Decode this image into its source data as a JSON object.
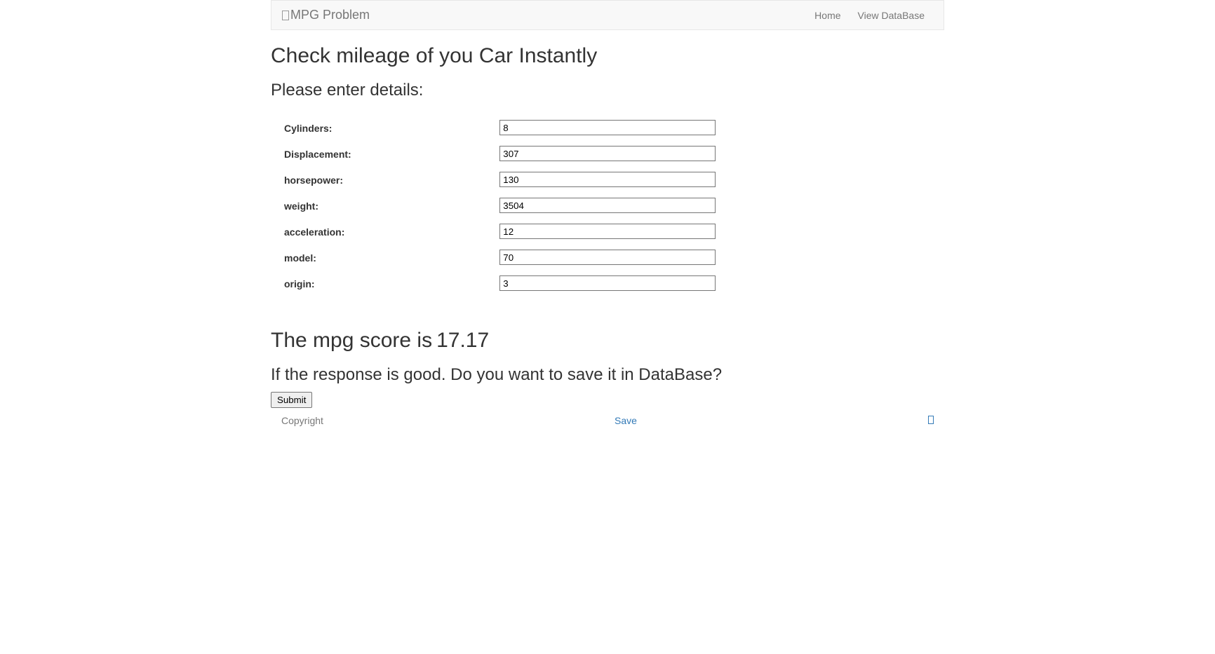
{
  "navbar": {
    "brand": "MPG Problem",
    "links": [
      {
        "label": "Home"
      },
      {
        "label": "View DataBase"
      }
    ]
  },
  "headings": {
    "title": "Check mileage of you Car Instantly",
    "subtitle": "Please enter details:"
  },
  "form": {
    "fields": [
      {
        "label": "Cylinders:",
        "value": "8"
      },
      {
        "label": "Displacement:",
        "value": "307"
      },
      {
        "label": "horsepower:",
        "value": "130"
      },
      {
        "label": "weight:",
        "value": "3504"
      },
      {
        "label": "acceleration:",
        "value": "12"
      },
      {
        "label": "model:",
        "value": "70"
      },
      {
        "label": "origin:",
        "value": "3"
      }
    ]
  },
  "result": {
    "label": "The mpg score is",
    "value": "17.17",
    "save_prompt": "If the response is good. Do you want to save it in DataBase?",
    "submit_label": "Submit"
  },
  "footer": {
    "copyright": "Copyright",
    "save": "Save"
  }
}
